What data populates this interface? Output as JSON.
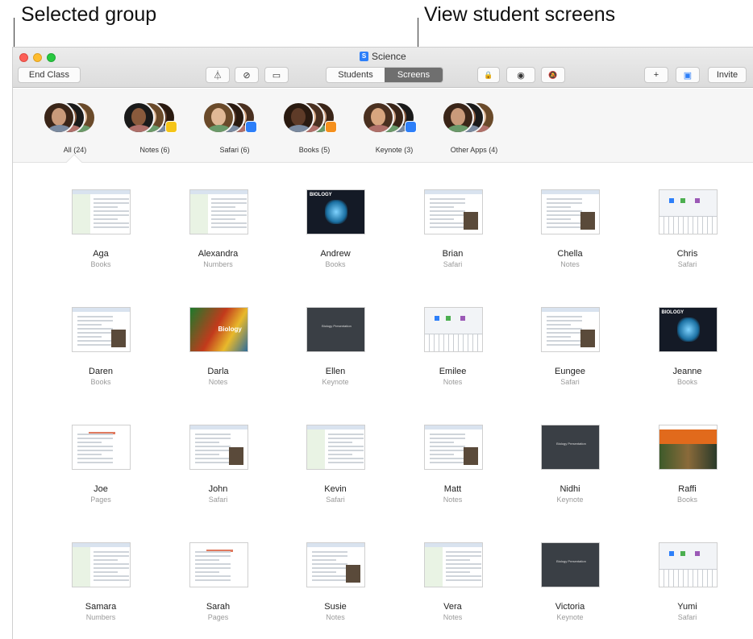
{
  "callouts": {
    "selected_group": "Selected group",
    "view_screens": "View student screens"
  },
  "window": {
    "title": "Science",
    "app_badge": "S",
    "toolbar": {
      "end_class": "End Class",
      "airdrop_icon": "⏃",
      "navigate_icon": "⊘",
      "airplay_icon": "▭",
      "seg_students": "Students",
      "seg_screens": "Screens",
      "lock_icon": "🔒",
      "eye_icon": "◉",
      "mute_icon": "🔕",
      "add_icon": "+",
      "screen_icon": "▣",
      "invite": "Invite"
    }
  },
  "groups": [
    {
      "label": "All (24)",
      "badge": ""
    },
    {
      "label": "Notes (6)",
      "badge": "#f5c518"
    },
    {
      "label": "Safari (6)",
      "badge": "#2d7ff9"
    },
    {
      "label": "Books (5)",
      "badge": "#f5901d"
    },
    {
      "label": "Keynote (3)",
      "badge": "#2d7ff9"
    },
    {
      "label": "Other Apps (4)",
      "badge": ""
    }
  ],
  "students": [
    {
      "name": "Aga",
      "app": "Books",
      "thumb": "side"
    },
    {
      "name": "Alexandra",
      "app": "Numbers",
      "thumb": "side"
    },
    {
      "name": "Andrew",
      "app": "Books",
      "thumb": "bio"
    },
    {
      "name": "Brian",
      "app": "Safari",
      "thumb": "doc"
    },
    {
      "name": "Chella",
      "app": "Notes",
      "thumb": "doc"
    },
    {
      "name": "Chris",
      "app": "Safari",
      "thumb": "kbd"
    },
    {
      "name": "Daren",
      "app": "Books",
      "thumb": "doc"
    },
    {
      "name": "Darla",
      "app": "Notes",
      "thumb": "parrot"
    },
    {
      "name": "Ellen",
      "app": "Keynote",
      "thumb": "key"
    },
    {
      "name": "Emilee",
      "app": "Notes",
      "thumb": "kbd"
    },
    {
      "name": "Eungee",
      "app": "Safari",
      "thumb": "doc"
    },
    {
      "name": "Jeanne",
      "app": "Books",
      "thumb": "bio"
    },
    {
      "name": "Joe",
      "app": "Pages",
      "thumb": "pages"
    },
    {
      "name": "John",
      "app": "Safari",
      "thumb": "doc"
    },
    {
      "name": "Kevin",
      "app": "Safari",
      "thumb": "side"
    },
    {
      "name": "Matt",
      "app": "Notes",
      "thumb": "doc"
    },
    {
      "name": "Nidhi",
      "app": "Keynote",
      "thumb": "key"
    },
    {
      "name": "Raffi",
      "app": "Books",
      "thumb": "web"
    },
    {
      "name": "Samara",
      "app": "Numbers",
      "thumb": "side"
    },
    {
      "name": "Sarah",
      "app": "Pages",
      "thumb": "pages"
    },
    {
      "name": "Susie",
      "app": "Notes",
      "thumb": "doc"
    },
    {
      "name": "Vera",
      "app": "Notes",
      "thumb": "side"
    },
    {
      "name": "Victoria",
      "app": "Keynote",
      "thumb": "key"
    },
    {
      "name": "Yumi",
      "app": "Safari",
      "thumb": "kbd"
    }
  ],
  "thumb_text": {
    "biology": "BIOLOGY",
    "biology_title": "Biology",
    "keynote": "Biology Presentation"
  }
}
